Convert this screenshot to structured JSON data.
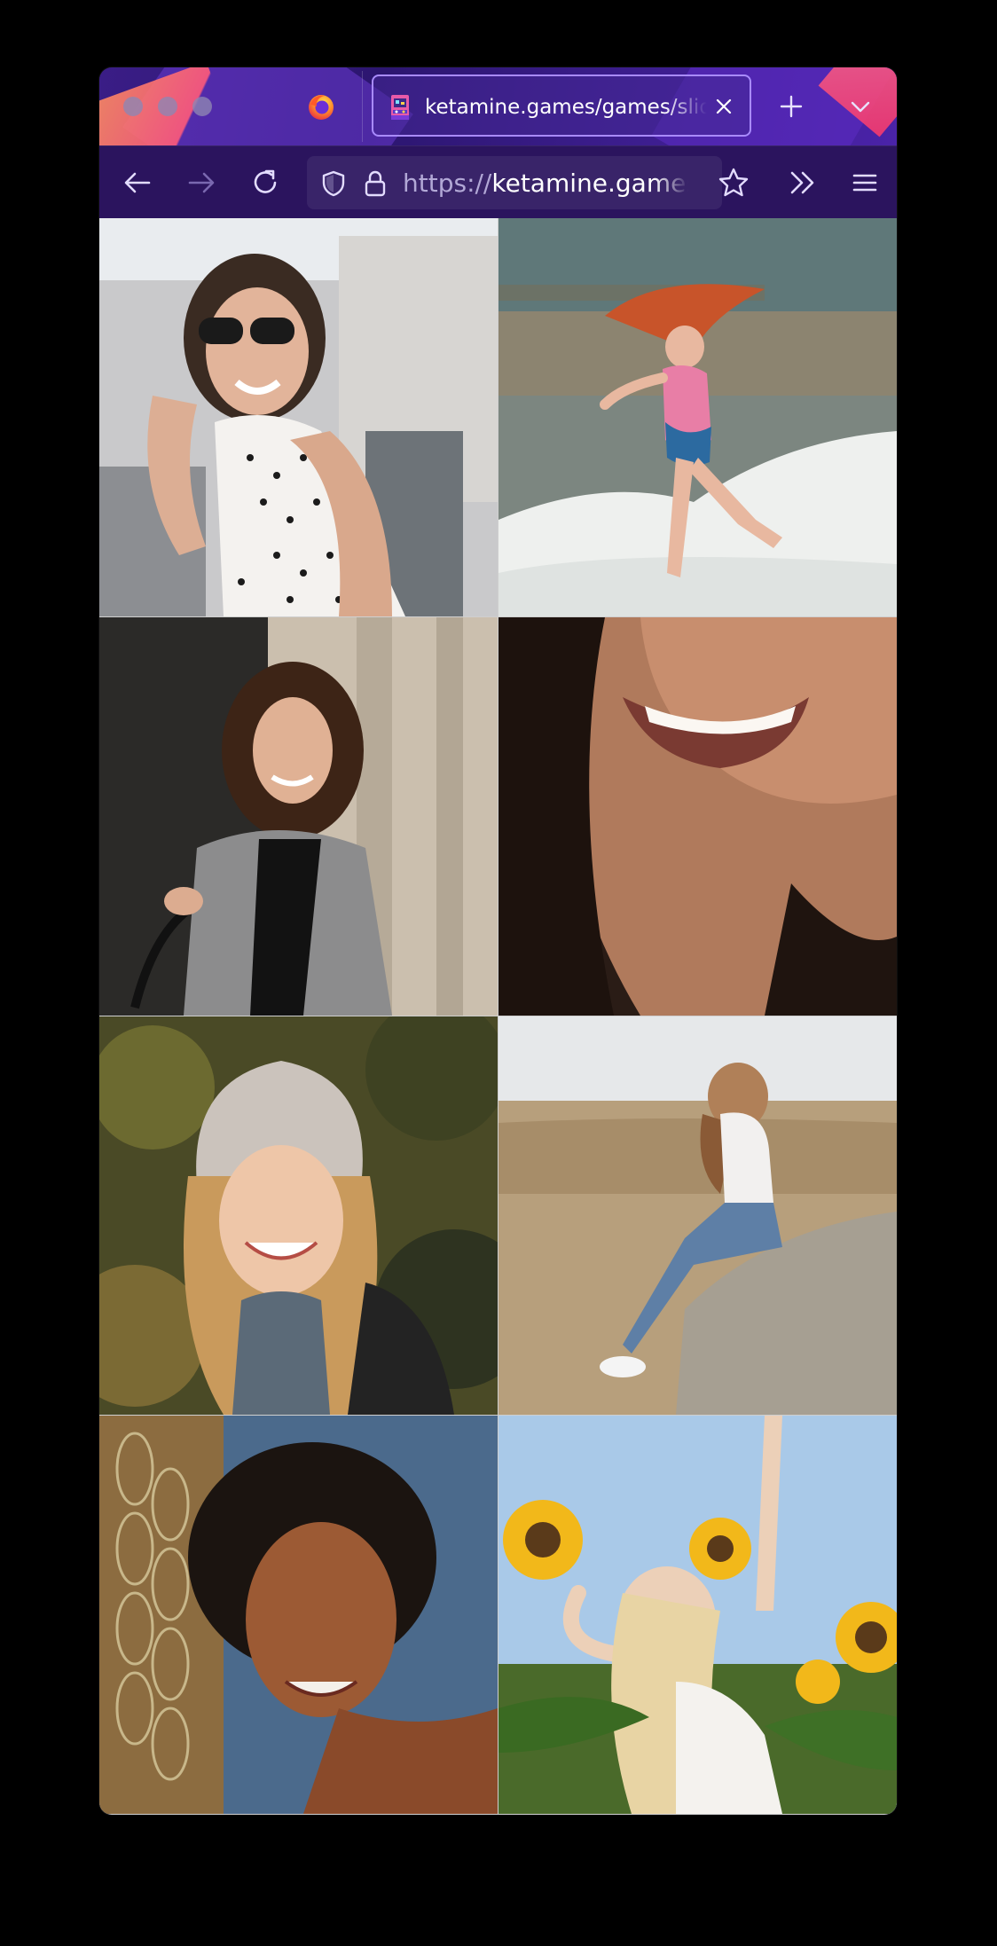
{
  "browser": {
    "name": "Firefox",
    "tab": {
      "title": "ketamine.games/games/slideshow",
      "favicon": "arcade-cabinet-icon"
    },
    "url": {
      "scheme": "https://",
      "host": "ketamine.games/games/slideshow"
    },
    "icons": {
      "back": "back-arrow-icon",
      "forward": "forward-arrow-icon",
      "reload": "reload-icon",
      "shield": "tracking-protection-shield-icon",
      "lock": "lock-icon",
      "bookmark": "star-icon",
      "overflow": "chevron-double-right-icon",
      "menu": "hamburger-menu-icon",
      "new_tab": "plus-icon",
      "tab_list": "chevron-down-icon",
      "close_tab": "close-icon"
    },
    "colors": {
      "tab_border": "#a98bff",
      "toolbar": "#2b145e",
      "tabstrip": "#3a1d86"
    }
  },
  "gallery": {
    "columns": 2,
    "rows": 4,
    "photos": [
      {
        "subject": "woman with sunglasses in polka-dot top"
      },
      {
        "subject": "red-haired girl running on beach"
      },
      {
        "subject": "curly-haired woman in grey coat"
      },
      {
        "subject": "close-up smiling mouth"
      },
      {
        "subject": "woman in knit beanie and scarf"
      },
      {
        "subject": "woman sitting on rock in dry grass field"
      },
      {
        "subject": "woman with curly hair behind chain fence"
      },
      {
        "subject": "blonde woman among sunflowers"
      }
    ]
  }
}
